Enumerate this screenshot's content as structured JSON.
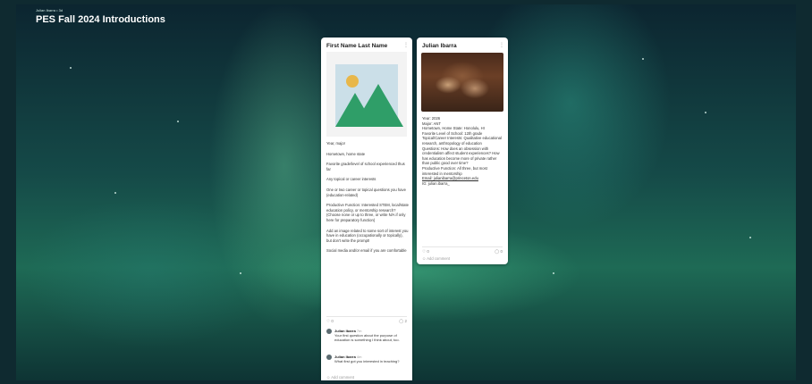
{
  "board": {
    "meta": "Julian Ibarra • 3d",
    "title": "PES Fall 2024 Introductions"
  },
  "columns": [
    {
      "title": "First Name Last Name",
      "image_icon": "image-placeholder-icon",
      "lines": [
        "Year, major",
        "Hometown, home state",
        "Favorite grade/level of school experienced thus far",
        "Any topical or career interests",
        "One or two career or topical questions you have (education-related)",
        "Productive Function: Interested STEM, local/state education policy, or mentorship research? (Choose none or up to three, or write N/A if only here for preparatory function)",
        "Add an image related to some sort of interest you have in education (occupationally or topically), but don't write the prompt!",
        "Social media and/or email if you are comfortable"
      ],
      "likes": "0",
      "comments_count": "2",
      "comments": [
        {
          "author": "Julian Ibarra",
          "time": "7m",
          "text": "Your first question about the purpose of education is something I think about, too."
        },
        {
          "author": "Julian Ibarra",
          "time": "4m",
          "text": "What first got you interested in teaching?"
        }
      ],
      "add_comment": "Add comment"
    },
    {
      "title": "Julian Ibarra",
      "lines": [
        "Year: 2026",
        "Major: ANT",
        "Hometown, Home State: Honolulu, HI",
        "Favorite Level of School: 12th grade",
        "Topical/Career Interests: Qualitative educational research, anthropology of education",
        "Questions: How does an obsession with credentialism affect student experiences? How has education become more of private rather than public good over time?",
        "Productive Function: All three, but most interested in mentorship",
        "Email: julianibarra@princeton.edu",
        "IG: julian.ibarra_"
      ],
      "likes": "0",
      "comments_count": "0",
      "add_comment": "Add comment"
    }
  ],
  "colors": {
    "accent": "#2f9e68",
    "sun": "#e8b74a"
  }
}
